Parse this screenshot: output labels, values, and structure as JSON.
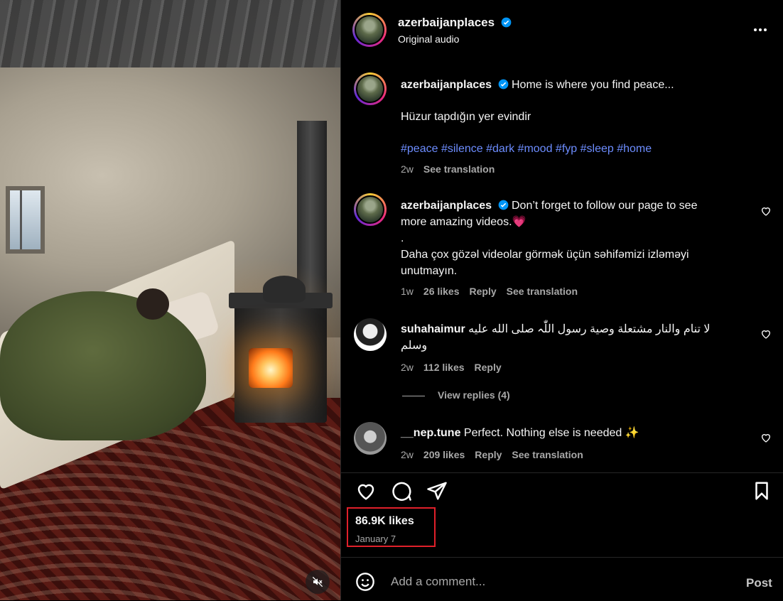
{
  "media": {
    "mute_icon": "speaker-muted-icon"
  },
  "header": {
    "username": "azerbaijanplaces",
    "subtitle": "Original audio",
    "more_icon": "more-icon"
  },
  "caption": {
    "username": "azerbaijanplaces",
    "line1": "Home is where you find peace...",
    "line2": "Hüzur tapdığın yer evindir",
    "hashtags": "#peace #silence #dark #mood #fyp #sleep #home",
    "time": "2w",
    "translate": "See translation"
  },
  "comments": [
    {
      "username": "azerbaijanplaces",
      "text_line1": "Don’t forget to follow our page to see more amazing videos.💗",
      "text_dot": ".",
      "text_line2": "Daha çox gözəl videolar görmək üçün səhifəmizi izləməyi unutmayın.",
      "time": "1w",
      "likes": "26 likes",
      "reply": "Reply",
      "translate": "See translation"
    },
    {
      "username": "suhahaimur",
      "text": "لا تنام والنار مشتعلة وصية رسول اللّٰہ صلى الله عليه وسلم",
      "time": "2w",
      "likes": "112 likes",
      "reply": "Reply"
    },
    {
      "username": "__nep.tune",
      "text": "Perfect. Nothing else is needed ✨",
      "time": "2w",
      "likes": "209 likes",
      "reply": "Reply",
      "translate": "See translation"
    }
  ],
  "view_replies": "View replies (4)",
  "stats": {
    "likes": "86.9K likes",
    "date": "January 7"
  },
  "add_comment": {
    "placeholder": "Add a comment...",
    "post_label": "Post"
  },
  "colors": {
    "hashtag": "#6d8dff",
    "verified": "#0095f6",
    "highlight_box": "#e0202a"
  }
}
